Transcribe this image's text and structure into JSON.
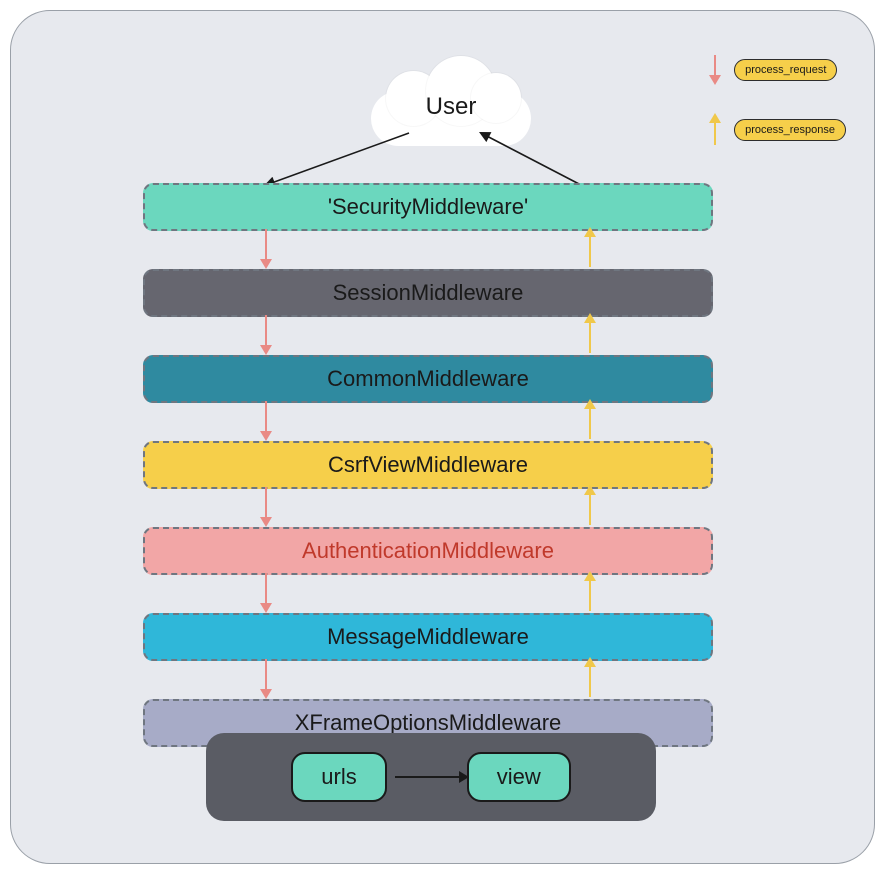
{
  "user_label": "User",
  "legend": {
    "request": "process_request",
    "response": "process_response"
  },
  "middlewares": [
    {
      "label": "'SecurityMiddleware'",
      "bg": "#6bd7be"
    },
    {
      "label": "SessionMiddleware",
      "bg": "#66666f"
    },
    {
      "label": "CommonMiddleware",
      "bg": "#2f8aa0"
    },
    {
      "label": "CsrfViewMiddleware",
      "bg": "#f6cf4a"
    },
    {
      "label": "AuthenticationMiddleware",
      "bg": "#f2a6a6",
      "pink": true
    },
    {
      "label": "MessageMiddleware",
      "bg": "#2fb7d9"
    },
    {
      "label": "XFrameOptionsMiddleware",
      "bg": "#a7abc7"
    }
  ],
  "endpoints": {
    "urls": "urls",
    "view": "view"
  },
  "colors": {
    "request_arrow": "#e98a85",
    "response_arrow": "#f0c84a",
    "legend_pill": "#f6cf4a",
    "bottom_box": "#5a5c64",
    "inner_pill": "#6bd7be",
    "frame_bg": "#e7e9ee"
  }
}
